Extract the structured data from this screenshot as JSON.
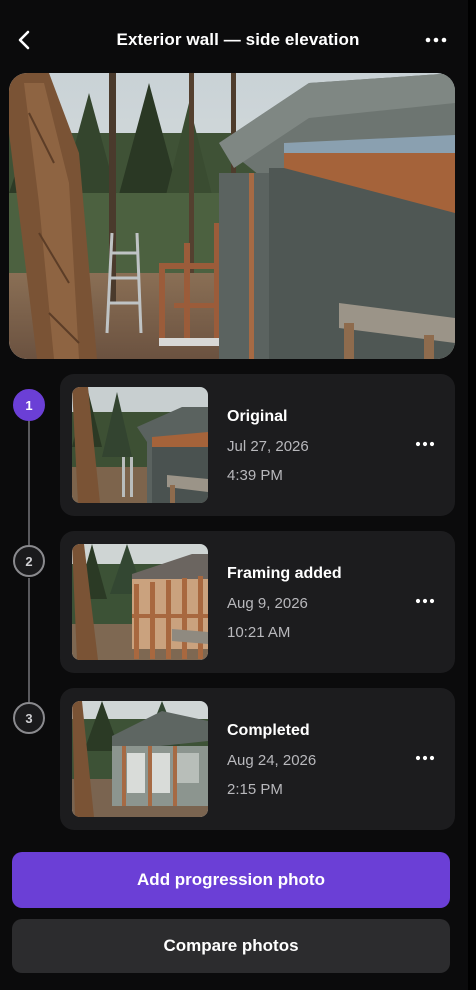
{
  "header": {
    "back_icon": "chevron-left-icon",
    "title": "Exterior wall — side elevation",
    "more_icon": "more-horizontal-icon"
  },
  "hero": {
    "image": "shed-exterior-wall-completed-photo"
  },
  "timeline": {
    "steps": [
      {
        "number": "1",
        "title": "Original",
        "date": "Jul 27, 2026",
        "time": "4:39 PM",
        "active": true,
        "thumbnail": "original-shed-photo"
      },
      {
        "number": "2",
        "title": "Framing added",
        "date": "Aug 9, 2026",
        "time": "10:21 AM",
        "active": false,
        "thumbnail": "framing-added-photo"
      },
      {
        "number": "3",
        "title": "Completed",
        "date": "Aug 24, 2026",
        "time": "2:15 PM",
        "active": false,
        "thumbnail": "completed-shed-photo"
      }
    ]
  },
  "actions": {
    "add_label": "Add progression photo",
    "compare_label": "Compare photos"
  },
  "colors": {
    "accent": "#6b3fd6",
    "background": "#0b0b0c",
    "card": "#1c1c1e",
    "secondary_button": "#2c2c2e",
    "muted_text": "#b8b8bc"
  }
}
